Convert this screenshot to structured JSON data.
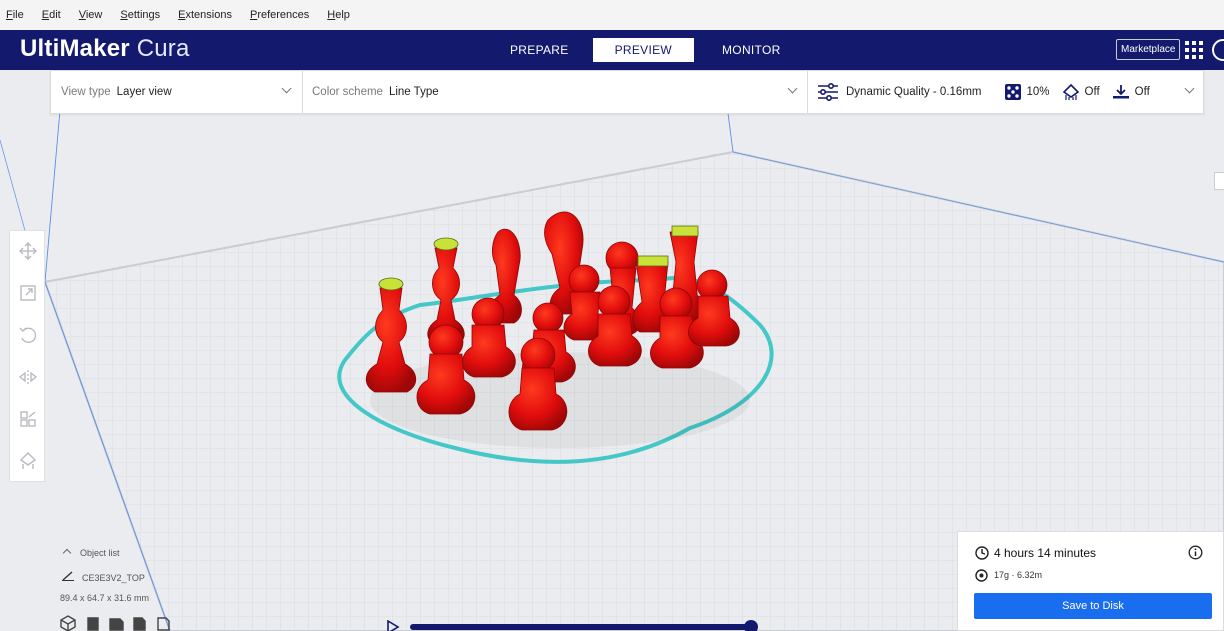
{
  "menu": [
    "File",
    "Edit",
    "View",
    "Settings",
    "Extensions",
    "Preferences",
    "Help"
  ],
  "header": {
    "logo_bold": "UltiMaker",
    "logo_light": " Cura",
    "tabs": [
      "PREPARE",
      "PREVIEW",
      "MONITOR"
    ],
    "active_tab": "PREVIEW",
    "marketplace": "Marketplace"
  },
  "toolbar": {
    "view_type_label": "View type",
    "view_type_value": "Layer view",
    "color_scheme_label": "Color scheme",
    "color_scheme_value": "Line Type",
    "quality": "Dynamic Quality - 0.16mm",
    "infill": "10%",
    "support": "Off",
    "adhesion": "Off"
  },
  "object_list": {
    "header": "Object list",
    "object_name": "CE3E3V2_TOP",
    "dimensions": "89.4 x 64.7 x 31.6 mm"
  },
  "print_info": {
    "time": "4 hours 14 minutes",
    "material": "17g · 6.32m",
    "save_button": "Save to Disk"
  },
  "colors": {
    "header_bg": "#13196d",
    "accent_blue": "#196ef0",
    "model_red": "#e10d0d",
    "skirt_cyan": "#44c7c7",
    "infill_yellow": "#c9e23a"
  },
  "layer_slider": {
    "position": 1.0
  }
}
